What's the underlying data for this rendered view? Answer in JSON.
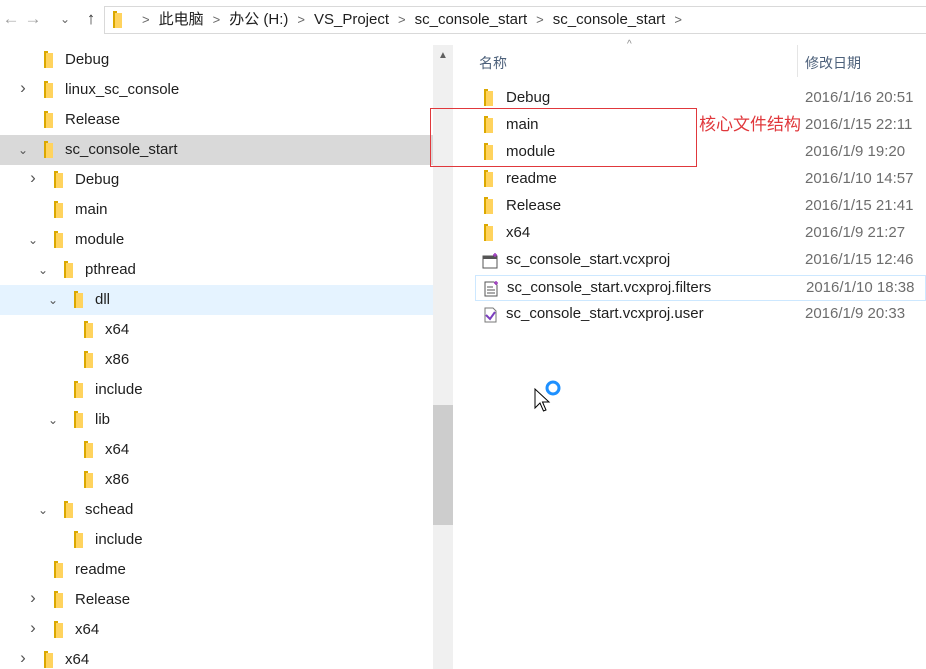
{
  "address_bar": {
    "back_icon": "back-arrow-icon",
    "forward_icon": "forward-arrow-icon",
    "up_icon": "up-arrow-icon",
    "breadcrumbs": [
      "此电脑",
      "办公 (H:)",
      "VS_Project",
      "sc_console_start",
      "sc_console_start"
    ]
  },
  "tree": {
    "items": [
      {
        "label": "Debug",
        "indent": 1,
        "chevron": "",
        "state": ""
      },
      {
        "label": "linux_sc_console",
        "indent": 1,
        "chevron": "collapsed",
        "state": ""
      },
      {
        "label": "Release",
        "indent": 1,
        "chevron": "",
        "state": ""
      },
      {
        "label": "sc_console_start",
        "indent": 1,
        "chevron": "expanded",
        "state": "selected"
      },
      {
        "label": "Debug",
        "indent": 2,
        "chevron": "collapsed",
        "state": ""
      },
      {
        "label": "main",
        "indent": 2,
        "chevron": "",
        "state": ""
      },
      {
        "label": "module",
        "indent": 2,
        "chevron": "expanded",
        "state": ""
      },
      {
        "label": "pthread",
        "indent": 3,
        "chevron": "expanded",
        "state": ""
      },
      {
        "label": "dll",
        "indent": 4,
        "chevron": "expanded",
        "state": "hover"
      },
      {
        "label": "x64",
        "indent": 5,
        "chevron": "",
        "state": ""
      },
      {
        "label": "x86",
        "indent": 5,
        "chevron": "",
        "state": ""
      },
      {
        "label": "include",
        "indent": 4,
        "chevron": "",
        "state": ""
      },
      {
        "label": "lib",
        "indent": 4,
        "chevron": "expanded",
        "state": ""
      },
      {
        "label": "x64",
        "indent": 5,
        "chevron": "",
        "state": ""
      },
      {
        "label": "x86",
        "indent": 5,
        "chevron": "",
        "state": ""
      },
      {
        "label": "schead",
        "indent": 3,
        "chevron": "expanded",
        "state": ""
      },
      {
        "label": "include",
        "indent": 4,
        "chevron": "",
        "state": ""
      },
      {
        "label": "readme",
        "indent": 2,
        "chevron": "",
        "state": ""
      },
      {
        "label": "Release",
        "indent": 2,
        "chevron": "collapsed",
        "state": ""
      },
      {
        "label": "x64",
        "indent": 2,
        "chevron": "collapsed",
        "state": ""
      },
      {
        "label": "x64",
        "indent": 1,
        "chevron": "collapsed",
        "state": ""
      }
    ]
  },
  "list_header": {
    "name_label": "名称",
    "date_label": "修改日期"
  },
  "files": [
    {
      "name": "Debug",
      "date": "2016/1/16 20:51",
      "icon": "folder-icon"
    },
    {
      "name": "main",
      "date": "2016/1/15 22:11",
      "icon": "folder-icon"
    },
    {
      "name": "module",
      "date": "2016/1/9 19:20",
      "icon": "folder-icon"
    },
    {
      "name": "readme",
      "date": "2016/1/10 14:57",
      "icon": "folder-icon"
    },
    {
      "name": "Release",
      "date": "2016/1/15 21:41",
      "icon": "folder-icon"
    },
    {
      "name": "x64",
      "date": "2016/1/9 21:27",
      "icon": "folder-icon"
    },
    {
      "name": "sc_console_start.vcxproj",
      "date": "2016/1/15 12:46",
      "icon": "vcxproj-icon"
    },
    {
      "name": "sc_console_start.vcxproj.filters",
      "date": "2016/1/10 18:38",
      "icon": "filters-file-icon"
    },
    {
      "name": "sc_console_start.vcxproj.user",
      "date": "2016/1/9 20:33",
      "icon": "visual-studio-user-icon"
    }
  ],
  "annotation": {
    "text": "核心文件结构",
    "color": "#e0383c"
  },
  "colors": {
    "selected_row": "#d9d9d9",
    "hover_row": "#e5f3ff",
    "folder": "#ffd35e"
  }
}
